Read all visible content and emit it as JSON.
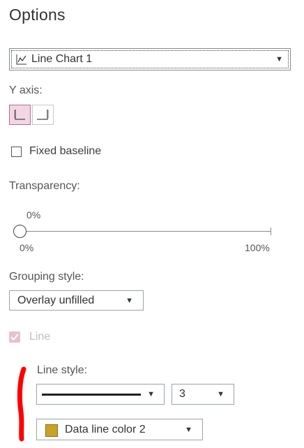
{
  "panel": {
    "title": "Options"
  },
  "chart_selector": {
    "value": "Line Chart 1",
    "icon": "line-chart-icon"
  },
  "y_axis": {
    "label": "Y axis:",
    "options": [
      "left-axis",
      "right-axis"
    ],
    "selected": "left-axis"
  },
  "fixed_baseline": {
    "label": "Fixed baseline",
    "checked": false
  },
  "transparency": {
    "label": "Transparency:",
    "value_label": "0%",
    "value": 0,
    "min_label": "0%",
    "max_label": "100%"
  },
  "grouping_style": {
    "label": "Grouping style:",
    "value": "Overlay unfilled"
  },
  "line_toggle": {
    "label": "Line",
    "checked": true,
    "disabled": true
  },
  "line_style": {
    "label": "Line style:",
    "pattern": "solid",
    "width_value": "3"
  },
  "line_color": {
    "value": "Data line color 2",
    "color": "#c9a227"
  },
  "annotation": {
    "color": "#ff0000"
  }
}
